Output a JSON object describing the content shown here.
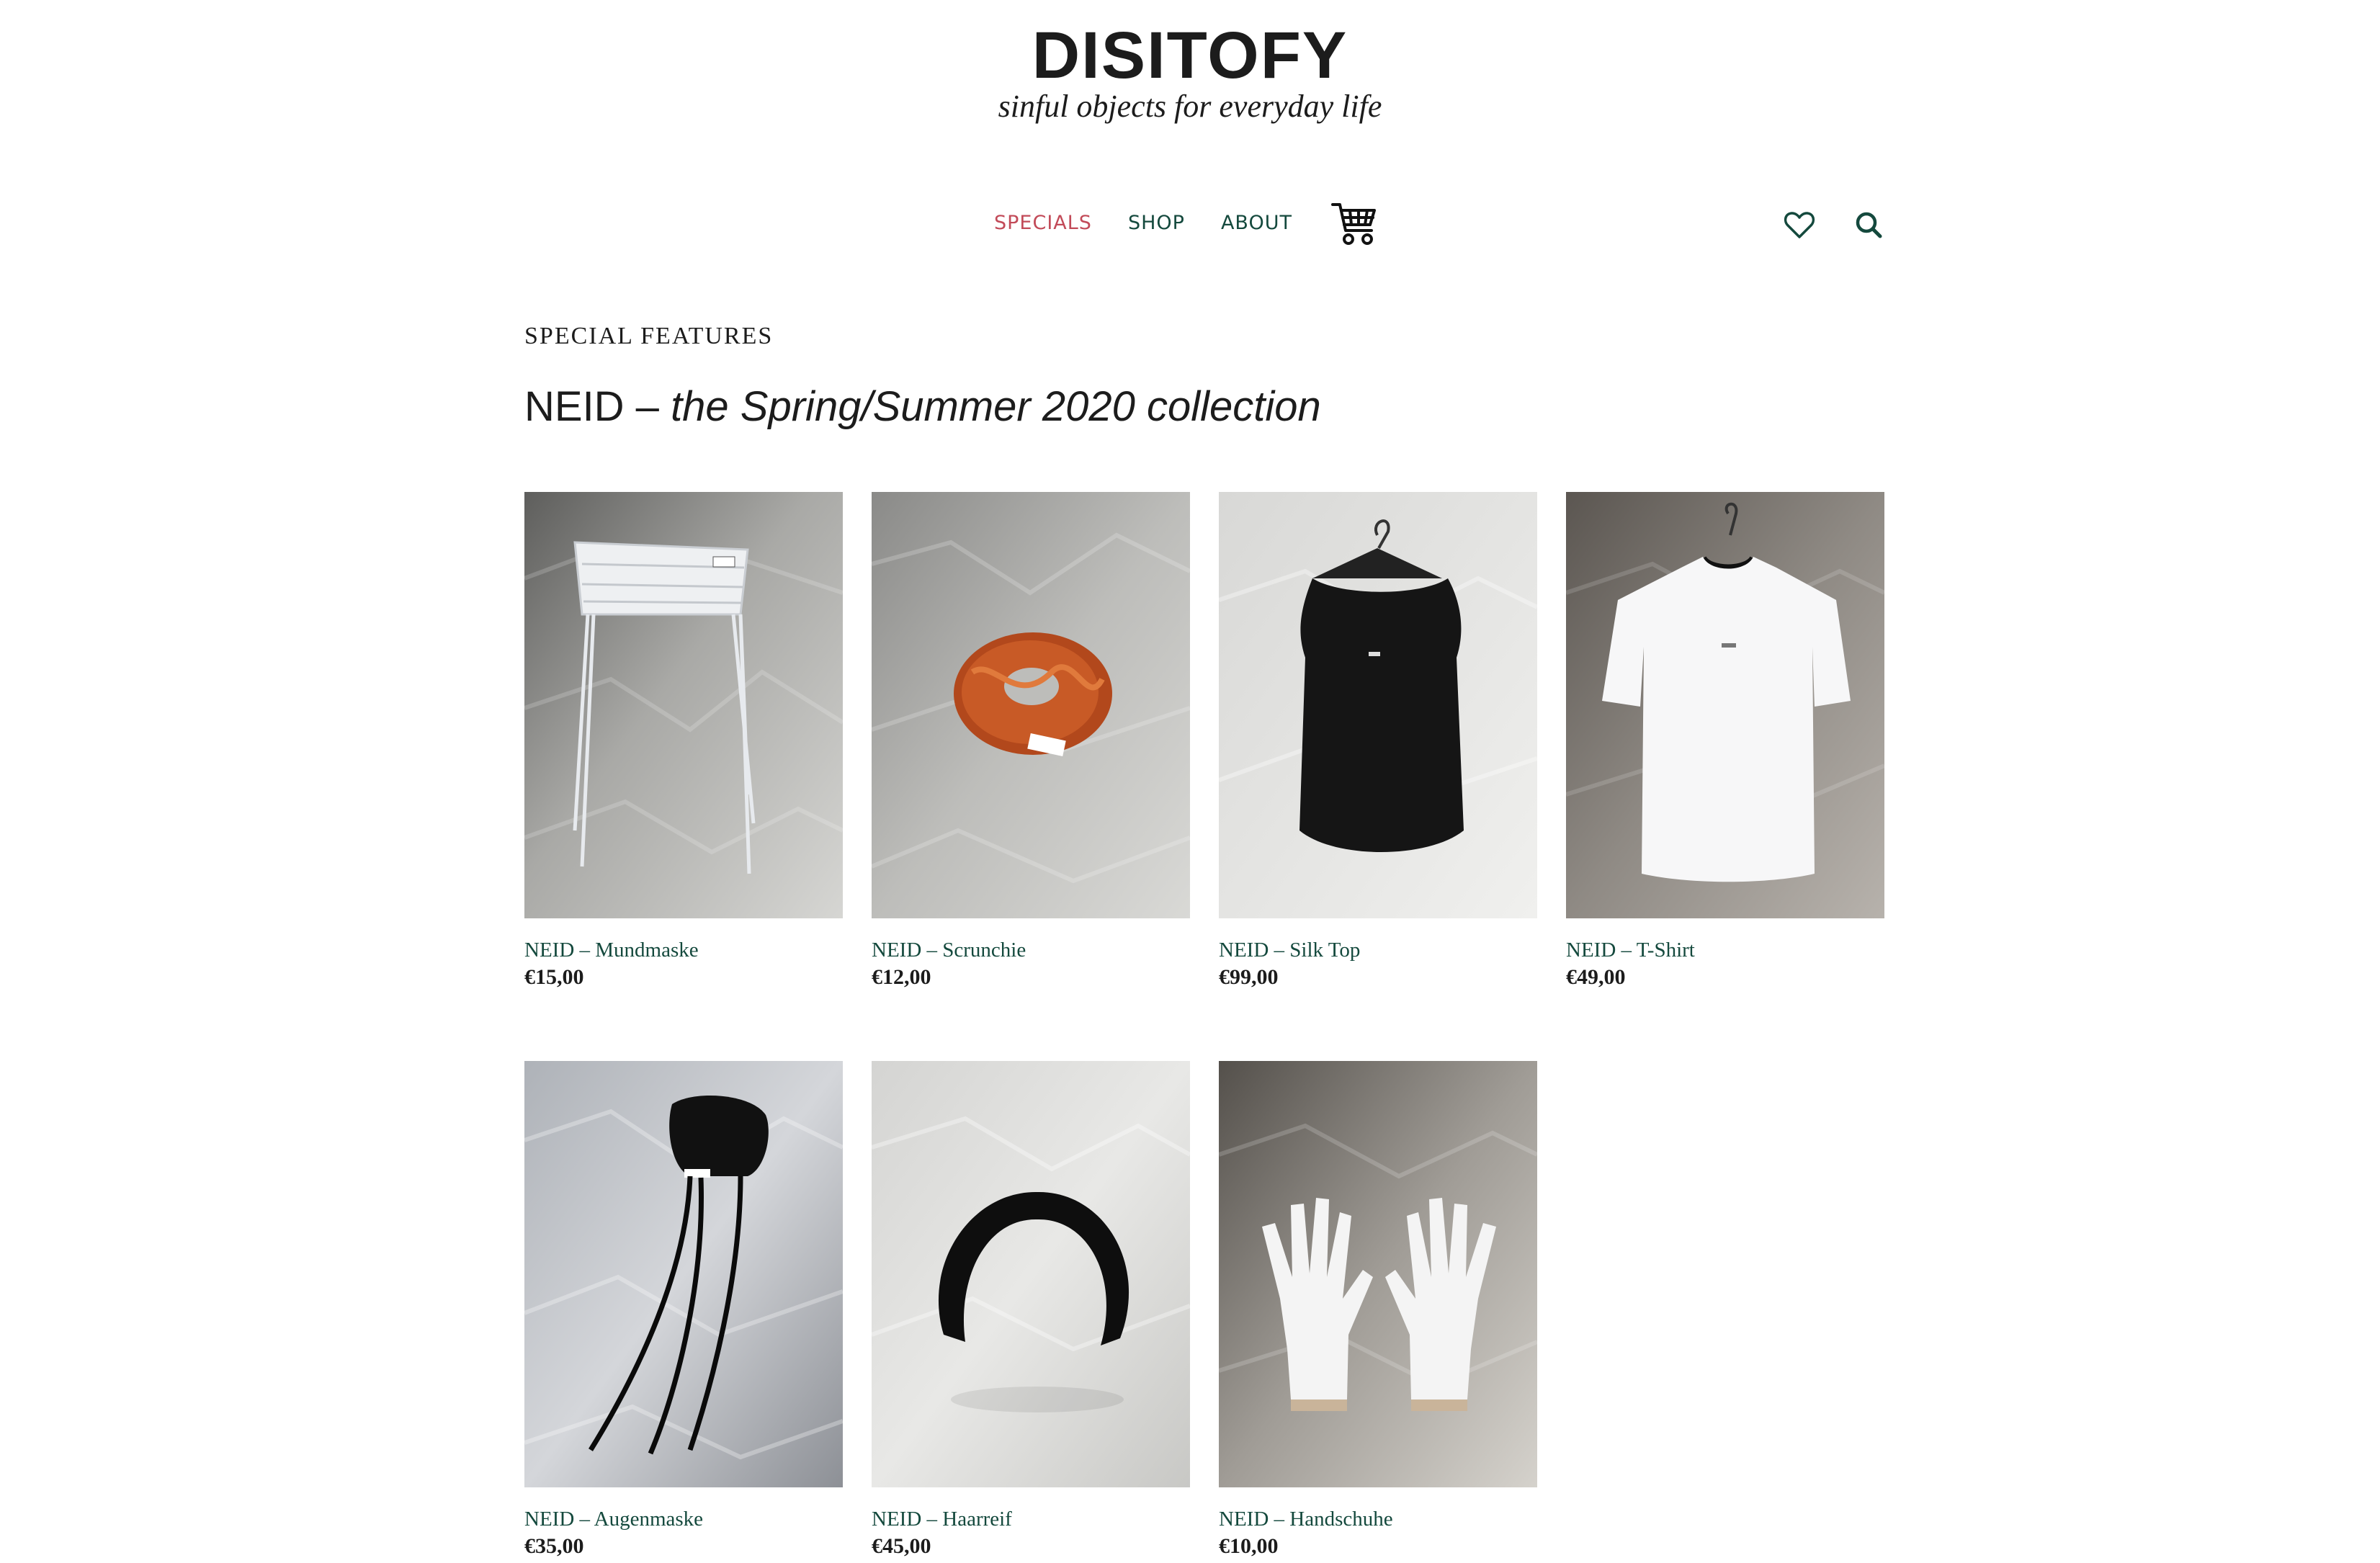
{
  "brand": {
    "name": "DISITOFY",
    "tagline": "sinful objects for everyday life"
  },
  "nav": {
    "items": [
      {
        "label": "SPECIALS",
        "active": true
      },
      {
        "label": "SHOP",
        "active": false
      },
      {
        "label": "ABOUT",
        "active": false
      }
    ],
    "cart_icon": "shopping-cart-icon",
    "wishlist_icon": "heart-icon",
    "search_icon": "search-icon"
  },
  "section": {
    "eyebrow": "SPECIAL FEATURES",
    "title_prefix": "NEID – ",
    "title_italic": "the Spring/Summer 2020 collection"
  },
  "products": [
    {
      "name": "NEID – Mundmaske",
      "price": "€15,00"
    },
    {
      "name": "NEID – Scrunchie",
      "price": "€12,00"
    },
    {
      "name": "NEID – Silk Top",
      "price": "€99,00"
    },
    {
      "name": "NEID – T-Shirt",
      "price": "€49,00"
    },
    {
      "name": "NEID – Augenmaske",
      "price": "€35,00"
    },
    {
      "name": "NEID – Haarreif",
      "price": "€45,00"
    },
    {
      "name": "NEID – Handschuhe",
      "price": "€10,00"
    }
  ],
  "colors": {
    "accent": "#c24a58",
    "link": "#14493d",
    "text": "#1c1c1c"
  }
}
